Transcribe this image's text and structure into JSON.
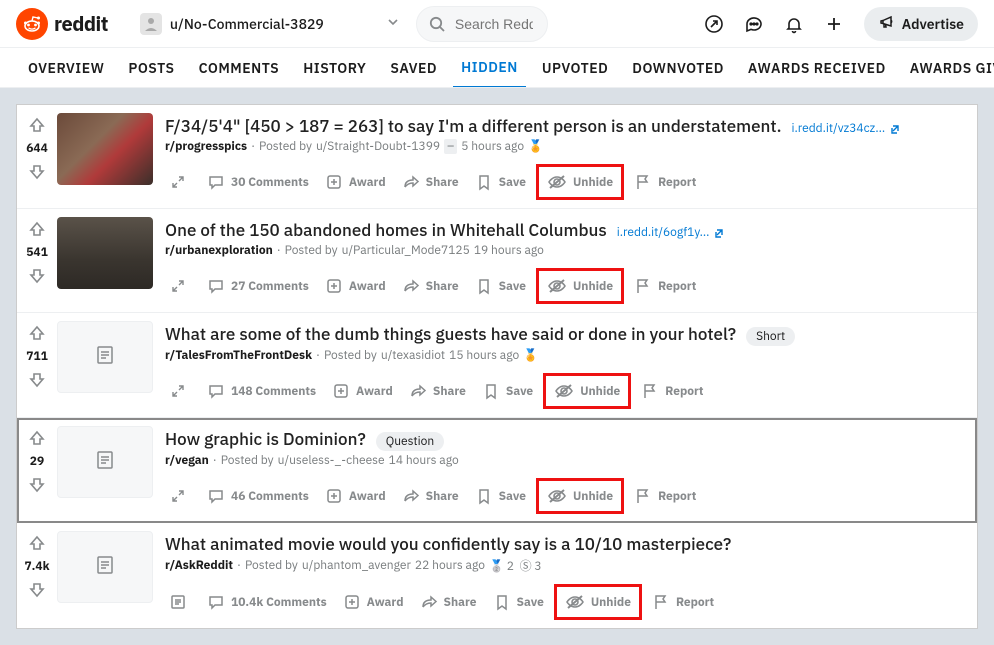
{
  "header": {
    "brand": "reddit",
    "user": "u/No-Commercial-3829",
    "search_placeholder": "Search Reddit",
    "advertise": "Advertise"
  },
  "tabs": [
    "OVERVIEW",
    "POSTS",
    "COMMENTS",
    "HISTORY",
    "SAVED",
    "HIDDEN",
    "UPVOTED",
    "DOWNVOTED",
    "AWARDS RECEIVED",
    "AWARDS GIVEN"
  ],
  "active_tab": "HIDDEN",
  "action_labels": {
    "award": "Award",
    "share": "Share",
    "save": "Save",
    "unhide": "Unhide",
    "report": "Report"
  },
  "posts": [
    {
      "score": "644",
      "thumb": "img1",
      "title": "F/34/5'4\" [450 > 187 = 263] to say I'm a different person is an understatement.",
      "outlink": "i.redd.it/vz34cz...",
      "subreddit": "r/progresspics",
      "author": "u/Straight-Doubt-1399",
      "time": "5 hours ago",
      "nsfw_icon": true,
      "award_icon": true,
      "comments": "30 Comments",
      "expand": "arrows"
    },
    {
      "score": "541",
      "thumb": "img2",
      "title": "One of the 150 abandoned homes in Whitehall Columbus",
      "outlink": "i.redd.it/6ogf1y...",
      "subreddit": "r/urbanexploration",
      "author": "u/Particular_Mode7125",
      "time": "19 hours ago",
      "comments": "27 Comments",
      "expand": "arrows"
    },
    {
      "score": "711",
      "thumb": "text",
      "title": "What are some of the dumb things guests have said or done in your hotel?",
      "flair": "Short",
      "subreddit": "r/TalesFromTheFrontDesk",
      "author": "u/texasidiot",
      "time": "15 hours ago",
      "award_icon": true,
      "comments": "148 Comments",
      "expand": "arrows"
    },
    {
      "score": "29",
      "thumb": "text",
      "title": "How graphic is Dominion?",
      "flair": "Question",
      "subreddit": "r/vegan",
      "author": "u/useless-_-cheese",
      "time": "14 hours ago",
      "comments": "46 Comments",
      "expand": "arrows",
      "focused": true
    },
    {
      "score": "7.4k",
      "thumb": "text",
      "title": "What animated movie would you confidently say is a 10/10 masterpiece?",
      "subreddit": "r/AskReddit",
      "author": "u/phantom_avenger",
      "time": "22 hours ago",
      "extra_badges": "2 3",
      "comments": "10.4k Comments",
      "expand": "card"
    }
  ]
}
